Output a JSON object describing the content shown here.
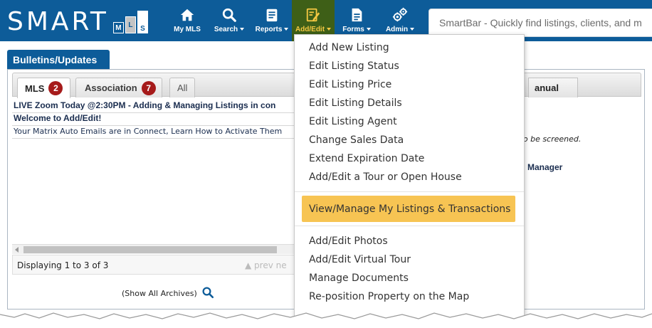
{
  "logo": {
    "text": "SMART",
    "boxes": [
      "M",
      "L",
      "S"
    ]
  },
  "nav": [
    {
      "label": "My MLS",
      "icon": "home-icon",
      "caret": false
    },
    {
      "label": "Search",
      "icon": "search-icon",
      "caret": true
    },
    {
      "label": "Reports",
      "icon": "clipboard-icon",
      "caret": true
    },
    {
      "label": "Add/Edit",
      "icon": "edit-icon",
      "caret": true,
      "active": true
    },
    {
      "label": "Forms",
      "icon": "document-icon",
      "caret": true
    },
    {
      "label": "Admin",
      "icon": "gears-icon",
      "caret": true
    }
  ],
  "smartbar": {
    "placeholder": "SmartBar - Quickly find listings, clients, and m"
  },
  "bulletins": {
    "title": "Bulletins/Updates",
    "tabs": {
      "mls": {
        "label": "MLS",
        "badge": "2"
      },
      "association": {
        "label": "Association",
        "badge": "7"
      },
      "all": {
        "label": "All"
      }
    },
    "rows": [
      "LIVE Zoom Today @2:30PM - Adding & Managing Listings in con",
      "Welcome to Add/Edit!",
      "Your Matrix Auto Emails are in Connect, Learn How to Activate Them"
    ],
    "display": "Displaying 1 to 3 of 3",
    "pager": "▲ prev   ne",
    "archives": "(Show All Archives)"
  },
  "right_panel": {
    "tab_label": "anual",
    "text1": "ts to be screened.",
    "text2": "Manager"
  },
  "dropdown": {
    "group1": [
      "Add New Listing",
      "Edit Listing Status",
      "Edit Listing Price",
      "Edit Listing Details",
      "Edit Listing Agent",
      "Change Sales Data",
      "Extend Expiration Date",
      "Add/Edit a Tour or Open House"
    ],
    "highlighted": "View/Manage My Listings & Transactions",
    "group2": [
      "Add/Edit Photos",
      "Add/Edit Virtual Tour",
      "Manage Documents",
      "Re-position Property on the Map"
    ]
  },
  "colors": {
    "nav_bg": "#0d5c99",
    "active_nav_bg": "#3e5f17",
    "active_nav_text": "#f5c842",
    "badge": "#a61b1b",
    "highlight": "#f7c453"
  }
}
